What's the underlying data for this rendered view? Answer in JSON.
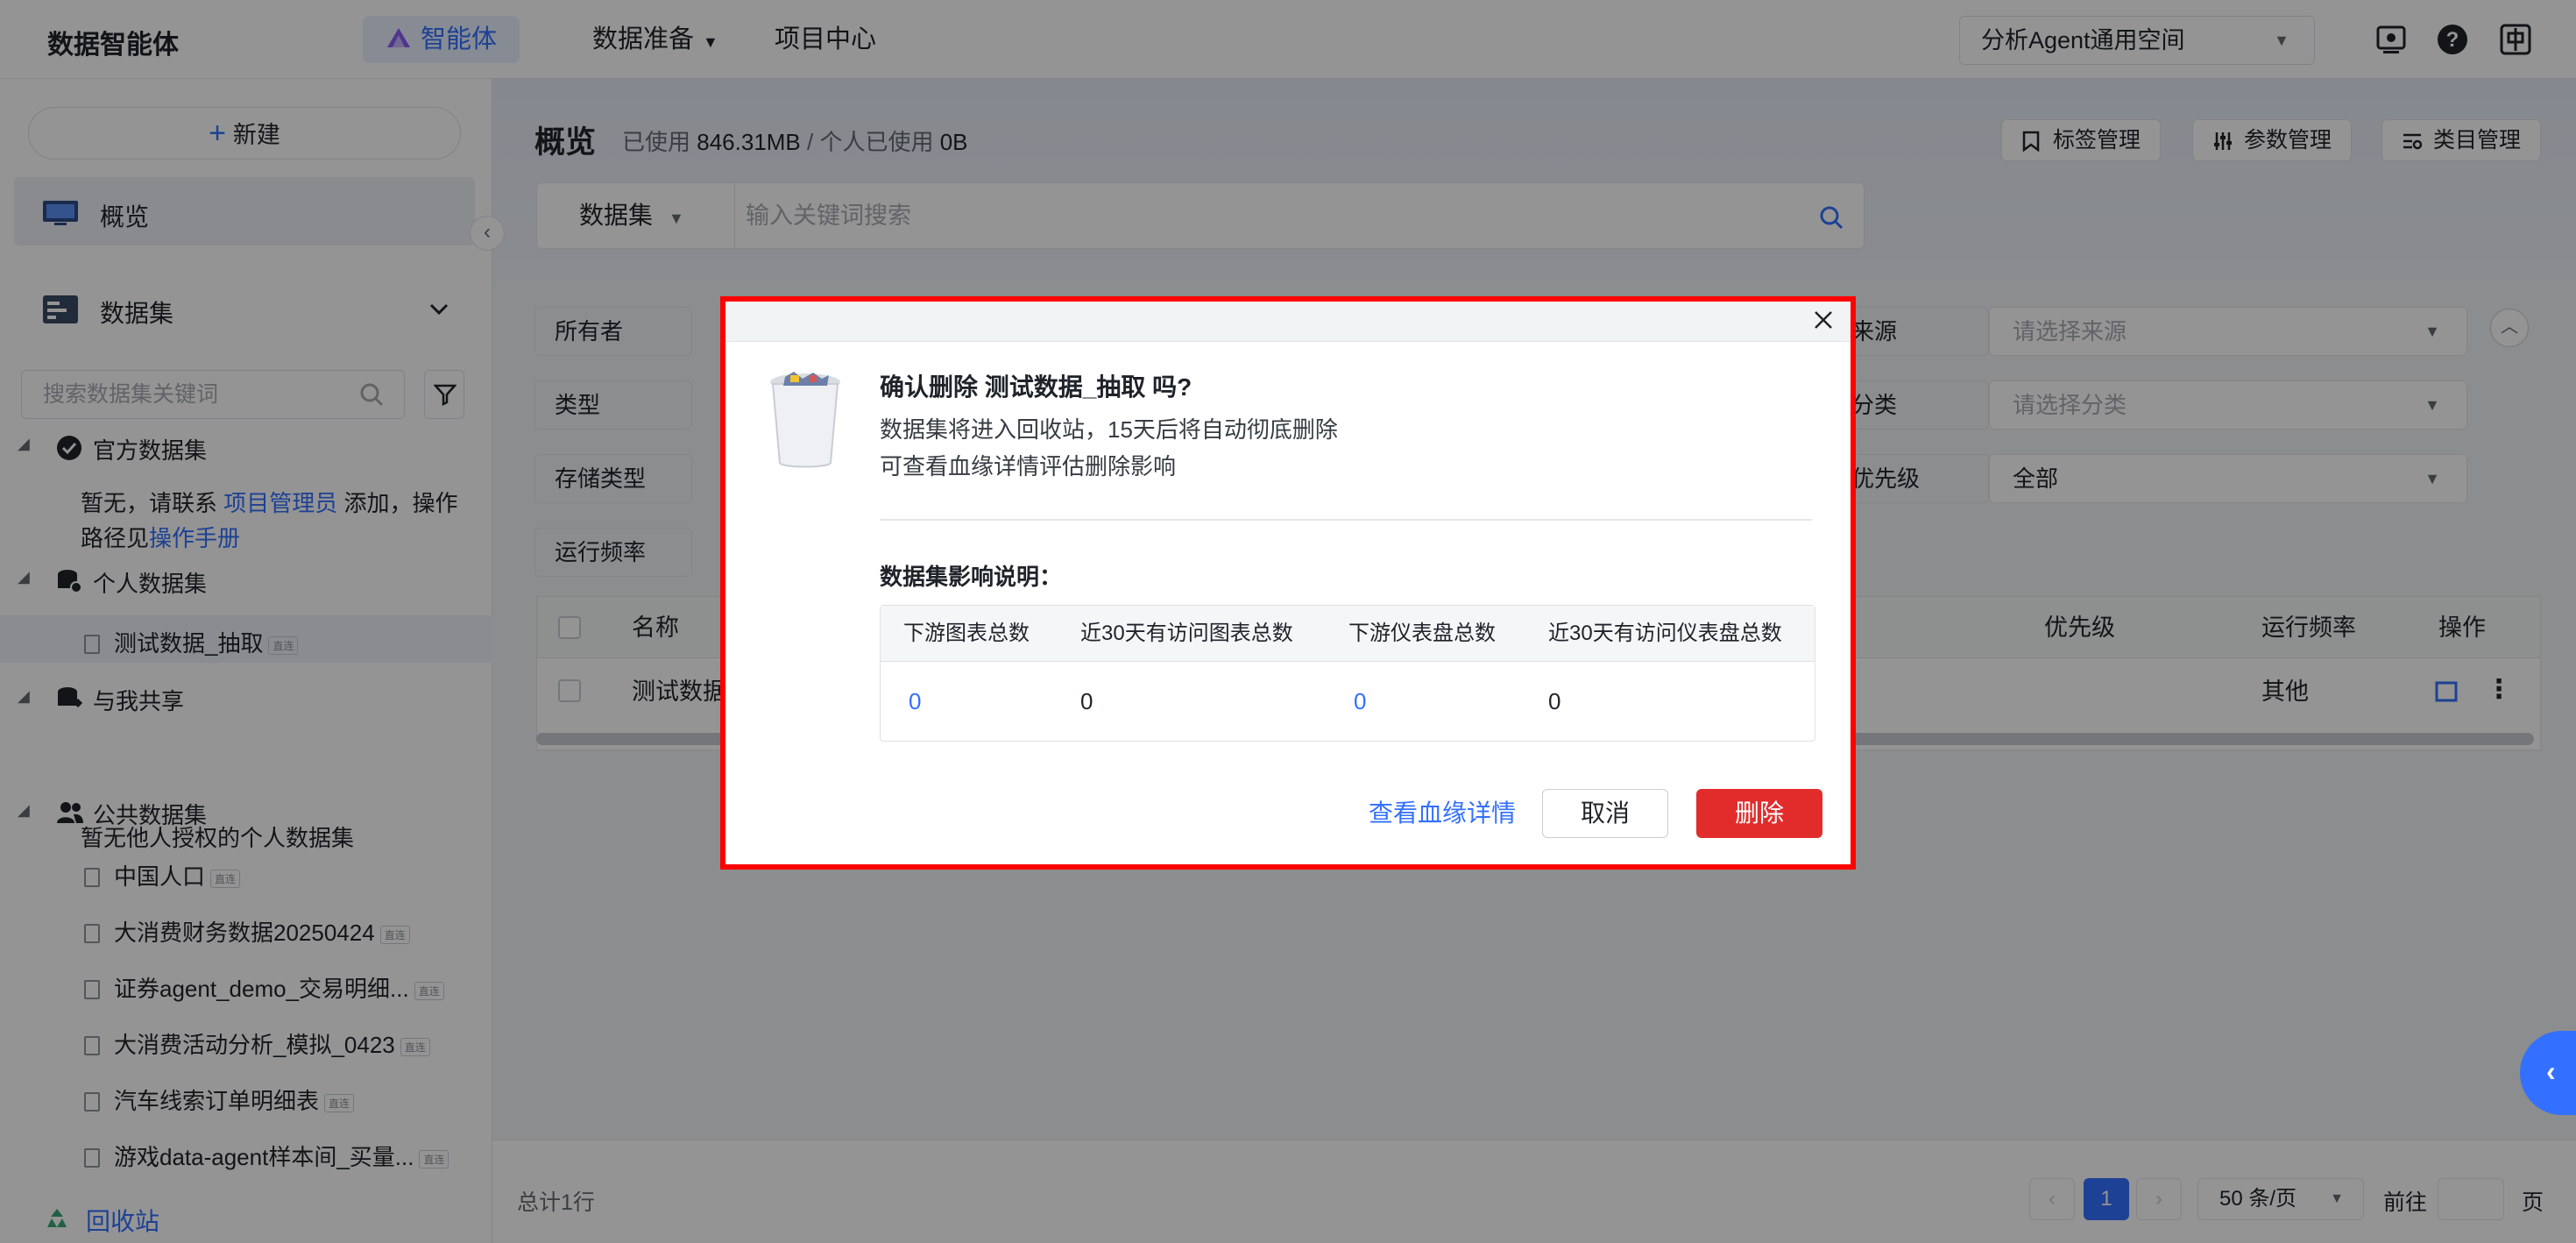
{
  "app": {
    "brand": "数据智能体",
    "nav": [
      {
        "label": "智能体"
      },
      {
        "label": "数据准备"
      },
      {
        "label": "项目中心"
      }
    ],
    "workspace": "分析Agent通用空间"
  },
  "sidebar": {
    "new_label": "新建",
    "overview_label": "概览",
    "datasets_label": "数据集",
    "search_placeholder": "搜索数据集关键词",
    "official": {
      "label": "官方数据集",
      "empty_prefix": "暂无，请联系 ",
      "empty_link": "项目管理员",
      "empty_middle": " 添加，操作路径见",
      "empty_link2": "操作手册"
    },
    "personal": {
      "label": "个人数据集",
      "items": [
        {
          "label": "测试数据_抽取",
          "tag": "直连"
        }
      ]
    },
    "shared": {
      "label": "与我共享",
      "empty": "暂无他人授权的个人数据集"
    },
    "public": {
      "label": "公共数据集",
      "items": [
        {
          "label": "中国人口",
          "tag": "直连"
        },
        {
          "label": "大消费财务数据20250424",
          "tag": "直连"
        },
        {
          "label": "证券agent_demo_交易明细...",
          "tag": "直连"
        },
        {
          "label": "大消费活动分析_模拟_0423",
          "tag": "直连"
        },
        {
          "label": "汽车线索订单明细表",
          "tag": "直连"
        },
        {
          "label": "游戏data-agent样本间_买量...",
          "tag": "直连"
        }
      ]
    },
    "recycle_label": "回收站"
  },
  "main": {
    "title": "概览",
    "usage_label": "已使用",
    "usage_value": "846.31MB",
    "usage_sep": " / ",
    "personal_usage_label": "个人已使用",
    "personal_usage_value": "0B",
    "tools": [
      {
        "label": "标签管理"
      },
      {
        "label": "参数管理"
      },
      {
        "label": "类目管理"
      }
    ],
    "search_type": "数据集",
    "search_placeholder": "输入关键词搜索",
    "filters_left": [
      {
        "label": "所有者"
      },
      {
        "label": "类型"
      },
      {
        "label": "存储类型"
      },
      {
        "label": "运行频率"
      }
    ],
    "filters_right": [
      {
        "label": "来源",
        "value": "请选择来源"
      },
      {
        "label": "分类",
        "value": "请选择分类"
      },
      {
        "label": "优先级",
        "value": "全部"
      }
    ],
    "table": {
      "headers": {
        "name": "名称",
        "priority": "优先级",
        "frequency": "运行频率",
        "ops": "操作"
      },
      "row": {
        "name": "测试数据",
        "frequency": "其他"
      }
    },
    "footer": {
      "total": "总计1行",
      "page": "1",
      "page_size": "50 条/页",
      "goto_label": "前往",
      "page_unit": "页"
    }
  },
  "modal": {
    "title": "确认删除 测试数据_抽取 吗?",
    "line1": "数据集将进入回收站，15天后将自动彻底删除",
    "line2": "可查看血缘详情评估删除影响",
    "impact_title": "数据集影响说明：",
    "columns": [
      "下游图表总数",
      "近30天有访问图表总数",
      "下游仪表盘总数",
      "近30天有访问仪表盘总数"
    ],
    "values": [
      "0",
      "0",
      "0",
      "0"
    ],
    "lineage_button": "查看血缘详情",
    "cancel_button": "取消",
    "delete_button": "删除"
  },
  "colors": {
    "accent": "#3370ff",
    "danger": "#e22c2c",
    "highlight": "#ff0000"
  }
}
